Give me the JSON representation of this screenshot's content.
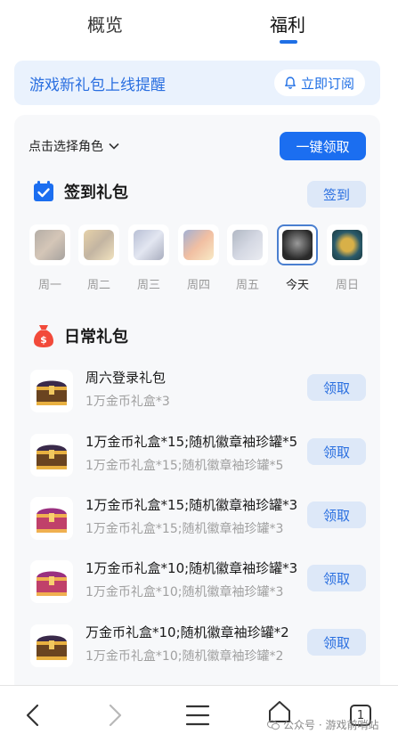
{
  "tabs": {
    "overview": "概览",
    "benefits": "福利"
  },
  "notice": {
    "text": "游戏新礼包上线提醒",
    "subscribe_label": "立即订阅"
  },
  "role_select": {
    "label": "点击选择角色"
  },
  "claim_all_label": "一键领取",
  "signin": {
    "title": "签到礼包",
    "button_label": "签到",
    "days": [
      {
        "label": "周一"
      },
      {
        "label": "周二"
      },
      {
        "label": "周三"
      },
      {
        "label": "周四"
      },
      {
        "label": "周五"
      },
      {
        "label": "今天"
      },
      {
        "label": "周日"
      }
    ]
  },
  "daily": {
    "title": "日常礼包",
    "items": [
      {
        "name": "周六登录礼包",
        "desc": "1万金币礼盒*3",
        "claim_label": "领取"
      },
      {
        "name": "1万金币礼盒*15;随机徽章袖珍罐*5",
        "desc": "1万金币礼盒*15;随机徽章袖珍罐*5",
        "claim_label": "领取"
      },
      {
        "name": "1万金币礼盒*15;随机徽章袖珍罐*3",
        "desc": "1万金币礼盒*15;随机徽章袖珍罐*3",
        "claim_label": "领取"
      },
      {
        "name": "1万金币礼盒*10;随机徽章袖珍罐*3",
        "desc": "1万金币礼盒*10;随机徽章袖珍罐*3",
        "claim_label": "领取"
      },
      {
        "name": "万金币礼盒*10;随机徽章袖珍罐*2",
        "desc": "1万金币礼盒*10;随机徽章袖珍罐*2",
        "claim_label": "领取"
      }
    ]
  },
  "bottom_nav": {
    "back_icon": "back-icon",
    "forward_icon": "forward-icon",
    "menu_icon": "menu-icon",
    "home_icon": "home-icon",
    "tabs_count": "1"
  },
  "watermark": "公众号 · 游戏前哨站",
  "colors": {
    "accent": "#1b6ef0",
    "notice_bg": "#eaf2fd",
    "soft_button_bg": "#dde8f8"
  }
}
